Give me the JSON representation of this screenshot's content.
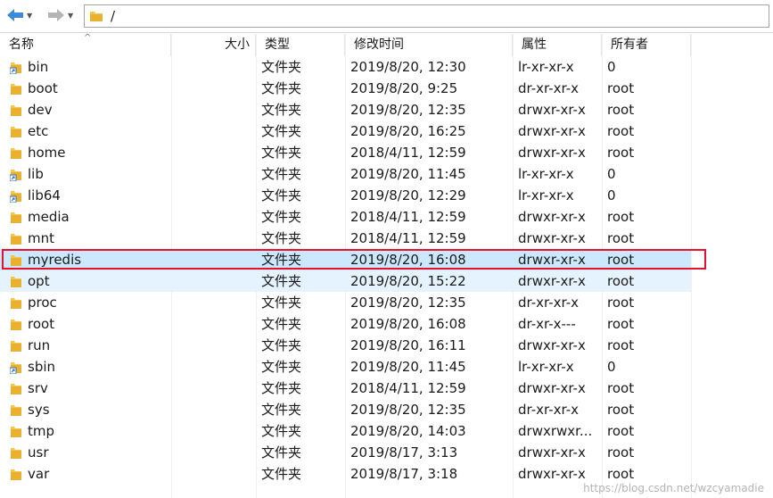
{
  "path": "/",
  "headers": {
    "name": "名称",
    "size": "大小",
    "type": "类型",
    "modified": "修改时间",
    "perm": "属性",
    "owner": "所有者"
  },
  "rows": [
    {
      "name": "bin",
      "type": "文件夹",
      "modified": "2019/8/20, 12:30",
      "perm": "lr-xr-xr-x",
      "owner": "0",
      "link": true
    },
    {
      "name": "boot",
      "type": "文件夹",
      "modified": "2019/8/20, 9:25",
      "perm": "dr-xr-xr-x",
      "owner": "root",
      "link": false
    },
    {
      "name": "dev",
      "type": "文件夹",
      "modified": "2019/8/20, 12:35",
      "perm": "drwxr-xr-x",
      "owner": "root",
      "link": false
    },
    {
      "name": "etc",
      "type": "文件夹",
      "modified": "2019/8/20, 16:25",
      "perm": "drwxr-xr-x",
      "owner": "root",
      "link": false
    },
    {
      "name": "home",
      "type": "文件夹",
      "modified": "2018/4/11, 12:59",
      "perm": "drwxr-xr-x",
      "owner": "root",
      "link": false
    },
    {
      "name": "lib",
      "type": "文件夹",
      "modified": "2019/8/20, 11:45",
      "perm": "lr-xr-xr-x",
      "owner": "0",
      "link": true
    },
    {
      "name": "lib64",
      "type": "文件夹",
      "modified": "2019/8/20, 12:29",
      "perm": "lr-xr-xr-x",
      "owner": "0",
      "link": true
    },
    {
      "name": "media",
      "type": "文件夹",
      "modified": "2018/4/11, 12:59",
      "perm": "drwxr-xr-x",
      "owner": "root",
      "link": false
    },
    {
      "name": "mnt",
      "type": "文件夹",
      "modified": "2018/4/11, 12:59",
      "perm": "drwxr-xr-x",
      "owner": "root",
      "link": false
    },
    {
      "name": "myredis",
      "type": "文件夹",
      "modified": "2019/8/20, 16:08",
      "perm": "drwxr-xr-x",
      "owner": "root",
      "link": false
    },
    {
      "name": "opt",
      "type": "文件夹",
      "modified": "2019/8/20, 15:22",
      "perm": "drwxr-xr-x",
      "owner": "root",
      "link": false
    },
    {
      "name": "proc",
      "type": "文件夹",
      "modified": "2019/8/20, 12:35",
      "perm": "dr-xr-xr-x",
      "owner": "root",
      "link": false
    },
    {
      "name": "root",
      "type": "文件夹",
      "modified": "2019/8/20, 16:08",
      "perm": "dr-xr-x---",
      "owner": "root",
      "link": false
    },
    {
      "name": "run",
      "type": "文件夹",
      "modified": "2019/8/20, 16:11",
      "perm": "drwxr-xr-x",
      "owner": "root",
      "link": false
    },
    {
      "name": "sbin",
      "type": "文件夹",
      "modified": "2019/8/20, 11:45",
      "perm": "lr-xr-xr-x",
      "owner": "0",
      "link": true
    },
    {
      "name": "srv",
      "type": "文件夹",
      "modified": "2018/4/11, 12:59",
      "perm": "drwxr-xr-x",
      "owner": "root",
      "link": false
    },
    {
      "name": "sys",
      "type": "文件夹",
      "modified": "2019/8/20, 12:35",
      "perm": "dr-xr-xr-x",
      "owner": "root",
      "link": false
    },
    {
      "name": "tmp",
      "type": "文件夹",
      "modified": "2019/8/20, 14:03",
      "perm": "drwxrwxr...",
      "owner": "root",
      "link": false
    },
    {
      "name": "usr",
      "type": "文件夹",
      "modified": "2019/8/17, 3:13",
      "perm": "drwxr-xr-x",
      "owner": "root",
      "link": false
    },
    {
      "name": "var",
      "type": "文件夹",
      "modified": "2019/8/17, 3:18",
      "perm": "drwxr-xr-x",
      "owner": "root",
      "link": false
    }
  ],
  "selected_row": "myredis",
  "hover_row": "opt",
  "watermark": "https://blog.csdn.net/wzcyamadie",
  "colors": {
    "folder": "#f3c74f",
    "selected_bg": "#cce8ff",
    "hover_bg": "#e5f3ff",
    "annotation_box": "#e8112d",
    "nav_back": "#3c8bd9"
  }
}
